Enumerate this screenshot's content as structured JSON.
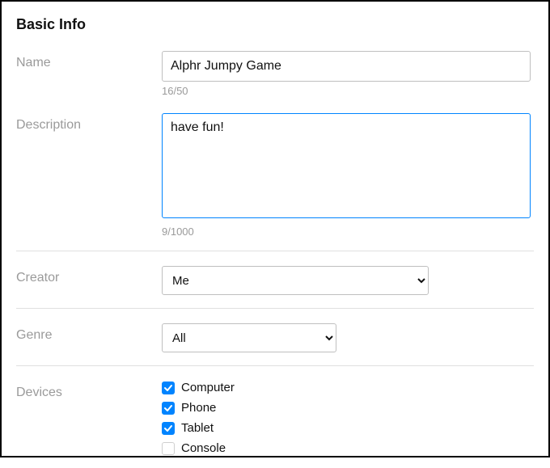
{
  "section_title": "Basic Info",
  "name": {
    "label": "Name",
    "value": "Alphr Jumpy Game",
    "counter": "16/50"
  },
  "description": {
    "label": "Description",
    "value": "have fun!",
    "counter": "9/1000"
  },
  "creator": {
    "label": "Creator",
    "value": "Me"
  },
  "genre": {
    "label": "Genre",
    "value": "All"
  },
  "devices": {
    "label": "Devices",
    "items": [
      {
        "label": "Computer",
        "checked": true
      },
      {
        "label": "Phone",
        "checked": true
      },
      {
        "label": "Tablet",
        "checked": true
      },
      {
        "label": "Console",
        "checked": false
      }
    ]
  }
}
